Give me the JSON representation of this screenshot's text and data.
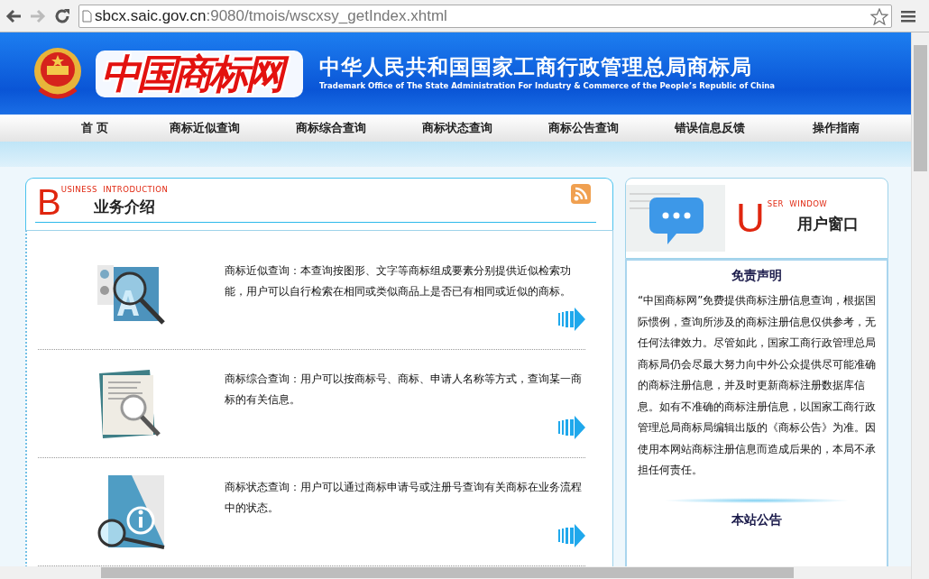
{
  "browser": {
    "url_host": "sbcx.saic.gov.cn",
    "url_rest": ":9080/tmois/wscxsy_getIndex.xhtml"
  },
  "header": {
    "logo_text": "中国商标网",
    "title": "中华人民共和国国家工商行政管理总局商标局",
    "subtitle": "Trademark Office of The State Administration For Industry & Commerce of the People’s Republic of China"
  },
  "nav": [
    "首 页",
    "商标近似查询",
    "商标综合查询",
    "商标状态查询",
    "商标公告查询",
    "错误信息反馈",
    "操作指南"
  ],
  "business": {
    "initial": "B",
    "heading_en": "USINESS  INTRODUCTION",
    "heading": "业务介绍",
    "items": [
      {
        "kind": "similar",
        "text": "商标近似查询：本查询按图形、文字等商标组成要素分别提供近似检索功能，用户可以自行检索在相同或类似商品上是否已有相同或近似的商标。"
      },
      {
        "kind": "combined",
        "text": "商标综合查询：用户可以按商标号、商标、申请人名称等方式，查询某一商标的有关信息。"
      },
      {
        "kind": "status",
        "text": "商标状态查询：用户可以通过商标申请号或注册号查询有关商标在业务流程中的状态。"
      }
    ]
  },
  "user_window": {
    "initial": "U",
    "heading_en": "SER  WINDOW",
    "heading": "用户窗口",
    "disclaimer_title": "免责声明",
    "disclaimer": "“中国商标网”免费提供商标注册信息查询，根据国际惯例，查询所涉及的商标注册信息仅供参考，无任何法律效力。尽管如此，国家工商行政管理总局商标局仍会尽最大努力向中外公众提供尽可能准确的商标注册信息，并及时更新商标注册数据库信息。如有不准确的商标注册信息，以国家工商行政管理总局商标局编辑出版的《商标公告》为准。因使用本网站商标注册信息而造成后果的，本局不承担任何责任。",
    "notice_title": "本站公告"
  }
}
